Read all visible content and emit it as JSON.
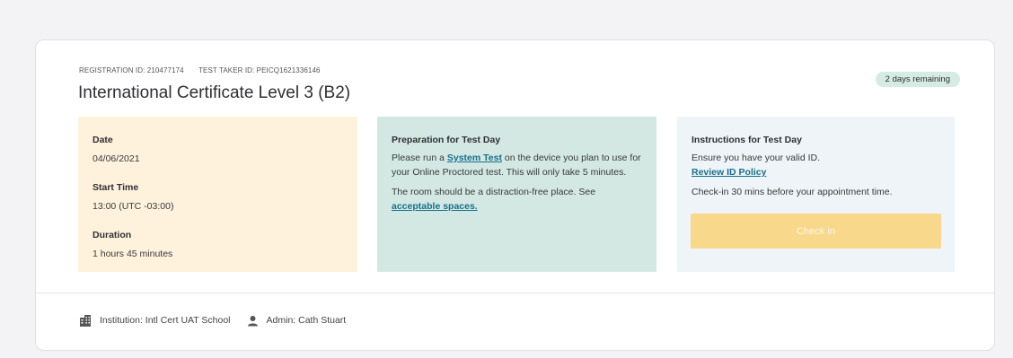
{
  "header": {
    "registration_id": "REGISTRATION ID: 210477174",
    "test_taker_id": "TEST TAKER ID: PEICQ1621336146",
    "title": "International Certificate Level 3 (B2)",
    "badge": "2 days remaining"
  },
  "date_panel": {
    "date_label": "Date",
    "date_value": "04/06/2021",
    "start_label": "Start Time",
    "start_value": "13:00 (UTC -03:00)",
    "duration_label": "Duration",
    "duration_value": "1 hours 45 minutes"
  },
  "prep_panel": {
    "heading": "Preparation for Test Day",
    "line1_before": "Please run a ",
    "line1_link": "System Test",
    "line1_after": " on the device you plan to use for your Online Proctored test. This will only take 5 minutes.",
    "line2_before": "The room should be a distraction-free place. See ",
    "line2_link": "acceptable spaces."
  },
  "instructions_panel": {
    "heading": "Instructions for Test Day",
    "line1": "Ensure you have your valid ID.",
    "id_link": "Review ID Policy",
    "line2": "Check-in 30 mins before your appointment time.",
    "checkin_label": "Check in"
  },
  "footer": {
    "institution": "Institution: Intl Cert UAT School",
    "admin": "Admin: Cath Stuart"
  },
  "colors": {
    "date_panel_bg": "#fef2dc",
    "prep_panel_bg": "#d3e8e3",
    "instructions_panel_bg": "#eef4f7",
    "badge_bg": "#d6ebe3",
    "link": "#17708c",
    "checkin_button": "#f8d88a"
  },
  "icons": {
    "institution": "building-icon",
    "admin": "person-icon"
  }
}
